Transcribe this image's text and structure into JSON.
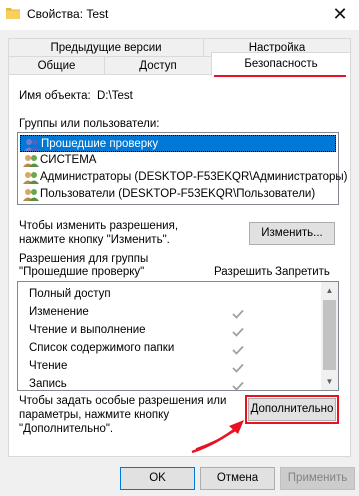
{
  "window": {
    "title": "Свойства: Test",
    "close_glyph": "✕"
  },
  "tabs": {
    "row1": [
      "Предыдущие версии",
      "Настройка"
    ],
    "row2": [
      "Общие",
      "Доступ",
      "Безопасность"
    ],
    "active": "Безопасность"
  },
  "object": {
    "label": "Имя объекта:",
    "value": "D:\\Test"
  },
  "groups": {
    "label": "Группы или пользователи:",
    "items": [
      "Прошедшие проверку",
      "СИСТЕМА",
      "Администраторы (DESKTOP-F53EKQR\\Администраторы)",
      "Пользователи (DESKTOP-F53EKQR\\Пользователи)"
    ],
    "selected_index": 0
  },
  "change": {
    "text_line1": "Чтобы изменить разрешения,",
    "text_line2": "нажмите кнопку \"Изменить\".",
    "button": "Изменить..."
  },
  "permissions": {
    "label_line1": "Разрешения для группы",
    "label_line2": "\"Прошедшие проверку\"",
    "col_allow": "Разрешить",
    "col_deny": "Запретить",
    "rows": [
      {
        "name": "Полный доступ",
        "allow": false,
        "deny": false
      },
      {
        "name": "Изменение",
        "allow": true,
        "deny": false
      },
      {
        "name": "Чтение и выполнение",
        "allow": true,
        "deny": false
      },
      {
        "name": "Список содержимого папки",
        "allow": true,
        "deny": false
      },
      {
        "name": "Чтение",
        "allow": true,
        "deny": false
      },
      {
        "name": "Запись",
        "allow": true,
        "deny": false
      }
    ]
  },
  "advanced": {
    "text_line1": "Чтобы задать особые разрешения или",
    "text_line2": "параметры, нажмите кнопку",
    "text_line3": "\"Дополнительно\".",
    "button": "Дополнительно"
  },
  "footer": {
    "ok": "OK",
    "cancel": "Отмена",
    "apply": "Применить"
  },
  "colors": {
    "selection": "#0078d7",
    "highlight": "#e81123",
    "check": "#a0a0a0"
  }
}
